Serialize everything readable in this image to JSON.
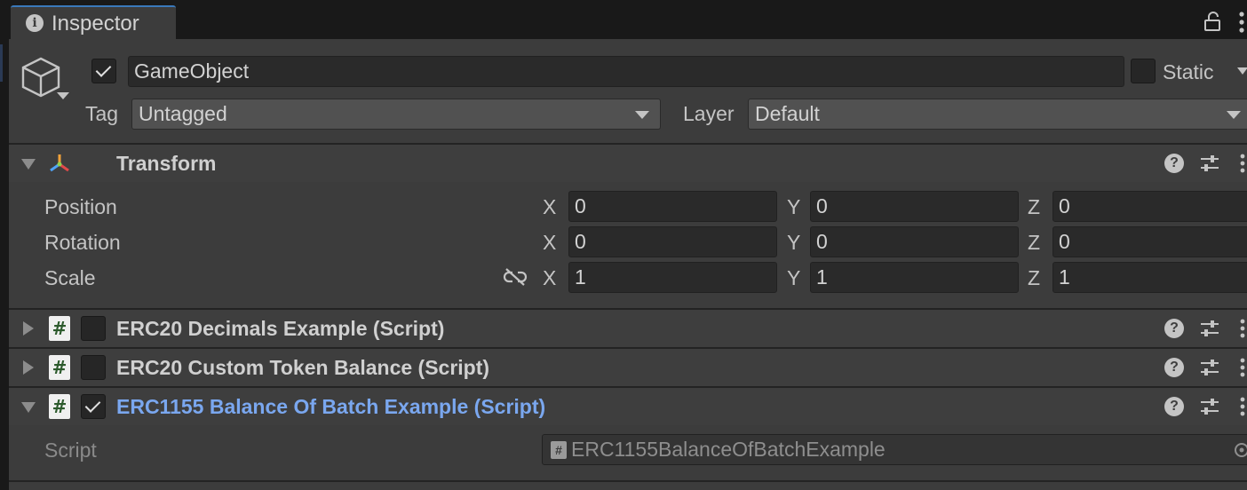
{
  "window": {
    "tab_title": "Inspector"
  },
  "gameobject": {
    "active": true,
    "name": "GameObject",
    "static_label": "Static",
    "static_checked": false,
    "tag_label": "Tag",
    "tag_value": "Untagged",
    "layer_label": "Layer",
    "layer_value": "Default"
  },
  "transform": {
    "title": "Transform",
    "expanded": true,
    "rows": [
      {
        "label": "Position",
        "x": "0",
        "y": "0",
        "z": "0"
      },
      {
        "label": "Rotation",
        "x": "0",
        "y": "0",
        "z": "0"
      },
      {
        "label": "Scale",
        "x": "1",
        "y": "1",
        "z": "1"
      }
    ],
    "axis": {
      "x": "X",
      "y": "Y",
      "z": "Z"
    }
  },
  "components": [
    {
      "title": "ERC20 Decimals Example (Script)",
      "enabled": false,
      "expanded": false
    },
    {
      "title": "ERC20 Custom Token Balance (Script)",
      "enabled": false,
      "expanded": false
    },
    {
      "title": "ERC1155 Balance Of Batch Example (Script)",
      "enabled": true,
      "expanded": true
    }
  ],
  "script_field": {
    "label": "Script",
    "value": "ERC1155BalanceOfBatchExample"
  },
  "icons": {
    "lock": "lock-icon",
    "menu": "kebab-menu-icon",
    "help": "help-icon",
    "presets": "sliders-icon",
    "gameobject": "cube-icon",
    "transform": "transform-axes-icon",
    "script": "hash-script-icon",
    "constrain": "unlinked-chain-icon",
    "object_picker": "target-icon"
  },
  "colors": {
    "accent_tab": "#3a79bb",
    "selected_component_title": "#7aa7ef"
  }
}
